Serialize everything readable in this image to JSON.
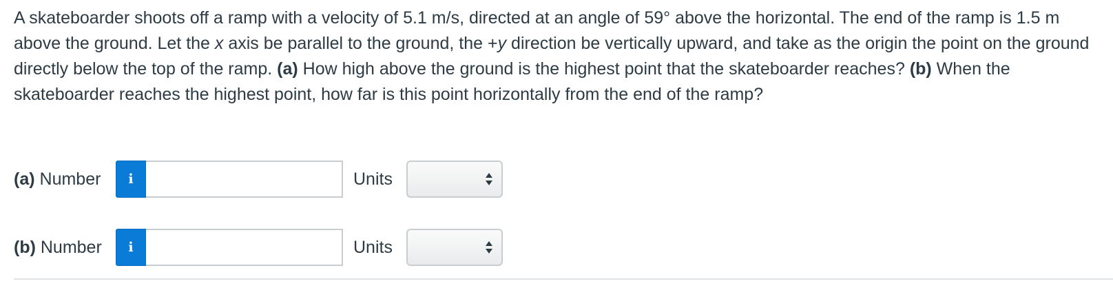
{
  "problem": {
    "intro": "A skateboarder shoots off a ramp with a velocity of 5.1 m/s, directed at an angle of 59° above the horizontal. The end of the ramp is 1.5 m above the ground. Let the ",
    "x_var": "x",
    "mid1": " axis be parallel to the ground, the +",
    "y_var": "y",
    "mid2": " direction be vertically upward, and take as the origin the point on the ground directly below the top of the ramp. ",
    "part_a_tag": "(a)",
    "part_a_text": " How high above the ground is the highest point that the skateboarder reaches? ",
    "part_b_tag": "(b)",
    "part_b_text": " When the skateboarder reaches the highest point, how far is this point horizontally from the end of the ramp?"
  },
  "answers": [
    {
      "tag": "(a)",
      "label": " Number",
      "info_icon": "i",
      "number_value": "",
      "units_label": "Units",
      "units_selected": ""
    },
    {
      "tag": "(b)",
      "label": " Number",
      "info_icon": "i",
      "number_value": "",
      "units_label": "Units",
      "units_selected": ""
    }
  ],
  "colors": {
    "info_button": "#0a7bd6",
    "text": "#2d3b45",
    "border": "#c7cdd1"
  }
}
